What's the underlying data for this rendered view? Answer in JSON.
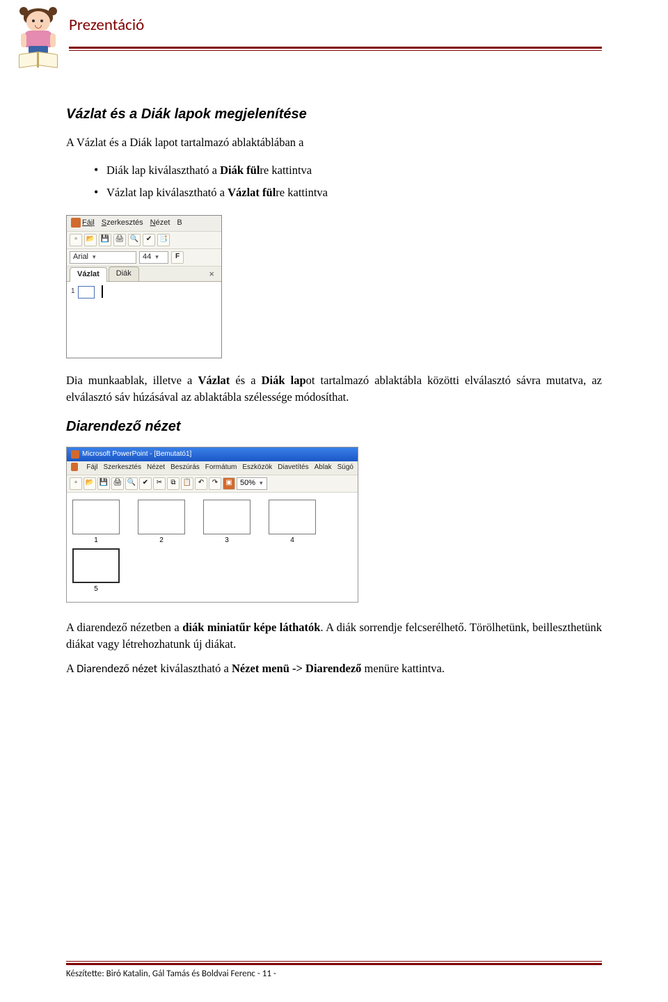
{
  "header": {
    "title": "Prezentáció"
  },
  "section1": {
    "heading": "Vázlat és a Diák lapok megjelenítése",
    "intro_a": "A Vázlat és a Diák lapot tartalmazó ablaktáblában a",
    "bullet1_a": "Diák lap kiválasztható a ",
    "bullet1_b": "Diák fül",
    "bullet1_c": "re kattintva",
    "bullet2_a": "Vázlat lap kiválasztható a ",
    "bullet2_b": "Vázlat fül",
    "bullet2_c": "re kattintva"
  },
  "fig1": {
    "menu": {
      "file": "Fájl",
      "edit": "Szerkesztés",
      "view": "Nézet",
      "extra": "B"
    },
    "font_name": "Arial",
    "font_size": "44",
    "bold": "F",
    "tab_outline": "Vázlat",
    "tab_slides": "Diák",
    "close": "×",
    "slide_num": "1"
  },
  "para_between": "Dia munkaablak, illetve a Vázlat és a Diák lapot tartalmazó ablaktábla közötti elválasztó sávra mutatva, az elválasztó sáv húzásával az ablaktábla szélessége módosíthat.",
  "para_between_bold1": "Vázlat",
  "para_between_bold2": "Diák lap",
  "section2": {
    "heading": "Diarendező nézet"
  },
  "fig2": {
    "title": "Microsoft PowerPoint - [Bemutató1]",
    "menu": [
      "Fájl",
      "Szerkesztés",
      "Nézet",
      "Beszúrás",
      "Formátum",
      "Eszközök",
      "Diavetítés",
      "Ablak",
      "Súgó"
    ],
    "zoom": "50%",
    "labels": [
      "1",
      "2",
      "3",
      "4",
      "5"
    ]
  },
  "para_after_fig2_a": "A diarendező nézetben a ",
  "para_after_fig2_b": "diák miniatűr képe láthatók",
  "para_after_fig2_c": ". A diák sorrendje felcserélhető. Törölhetünk, beilleszthetünk diákat vagy létrehozhatunk új diákat.",
  "para_last_a": "A ",
  "para_last_b": "Diarendező nézet",
  "para_last_c": " kiválasztható a ",
  "para_last_d": "Nézet menü -> Diarendező",
  "para_last_e": " menüre kattintva.",
  "footer": {
    "text_a": "Készítette: Biró Katalin, Gál Tamás és Boldvai Ferenc",
    "page": "- 11 -"
  }
}
